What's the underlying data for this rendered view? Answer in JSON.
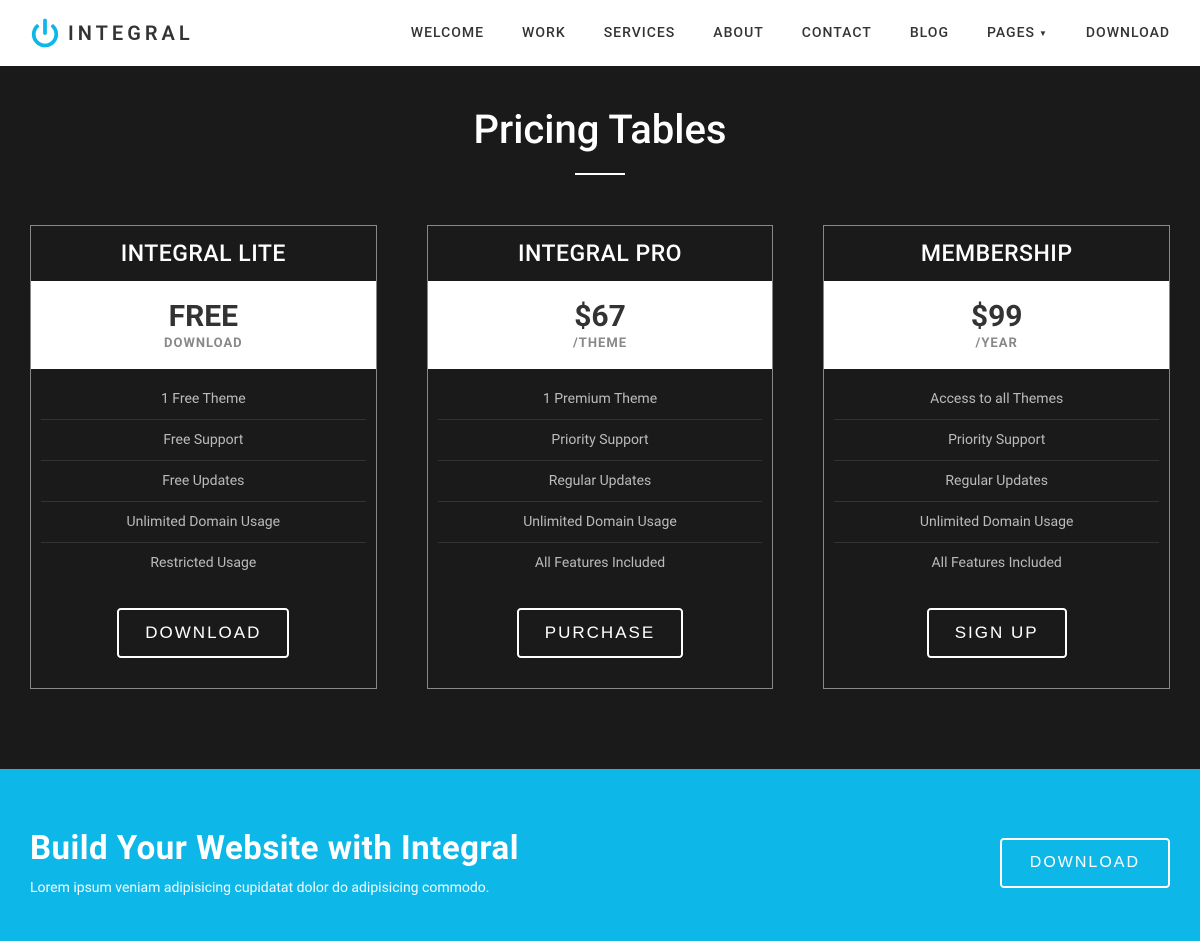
{
  "brand": {
    "name": "INTEGRAL"
  },
  "nav": {
    "welcome": "WELCOME",
    "work": "WORK",
    "services": "SERVICES",
    "about": "ABOUT",
    "contact": "CONTACT",
    "blog": "BLOG",
    "pages": "PAGES",
    "download": "DOWNLOAD"
  },
  "pricing": {
    "title": "Pricing Tables",
    "plans": [
      {
        "name": "INTEGRAL LITE",
        "price": "FREE",
        "period": "DOWNLOAD",
        "features": [
          "1 Free Theme",
          "Free Support",
          "Free Updates",
          "Unlimited Domain Usage",
          "Restricted Usage"
        ],
        "button": "DOWNLOAD"
      },
      {
        "name": "INTEGRAL PRO",
        "price": "$67",
        "period": "/THEME",
        "features": [
          "1 Premium Theme",
          "Priority Support",
          "Regular Updates",
          "Unlimited Domain Usage",
          "All Features Included"
        ],
        "button": "PURCHASE"
      },
      {
        "name": "MEMBERSHIP",
        "price": "$99",
        "period": "/YEAR",
        "features": [
          "Access to all Themes",
          "Priority Support",
          "Regular Updates",
          "Unlimited Domain Usage",
          "All Features Included"
        ],
        "button": "SIGN UP"
      }
    ]
  },
  "cta": {
    "title": "Build Your Website with Integral",
    "subtitle": "Lorem ipsum veniam adipisicing cupidatat dolor do adipisicing commodo.",
    "button": "DOWNLOAD"
  }
}
